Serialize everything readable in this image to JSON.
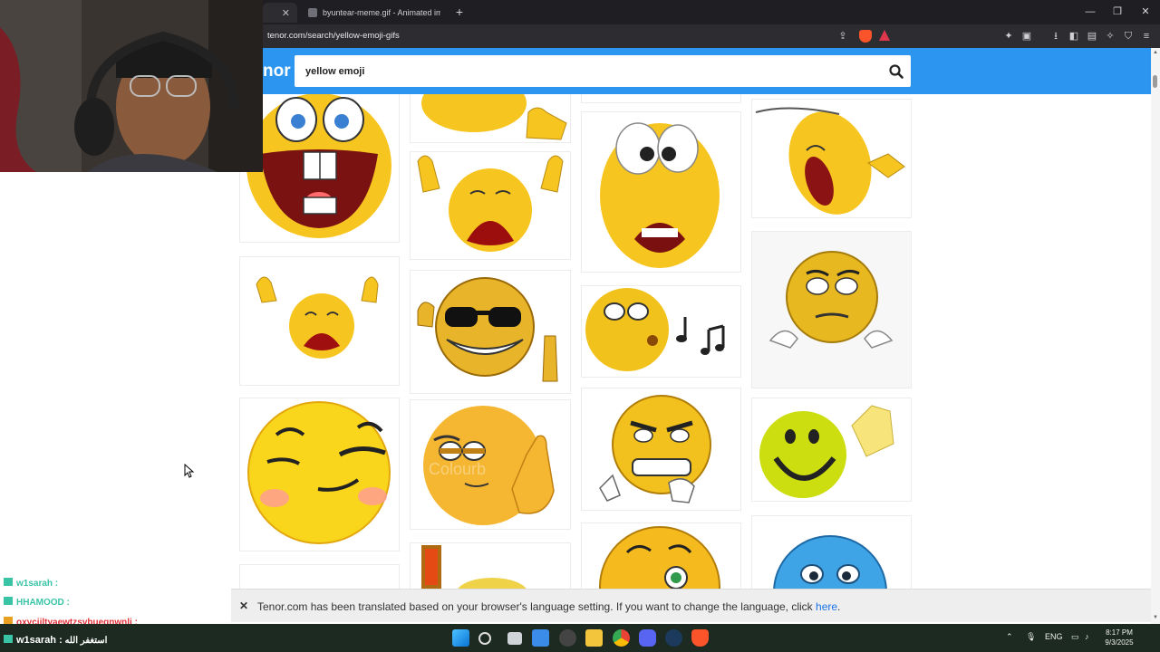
{
  "browser": {
    "tabs": [
      {
        "label": ""
      },
      {
        "label": "byuntear-meme.gif - Animated imag"
      }
    ],
    "url": "tenor.com/search/yellow-emoji-gifs"
  },
  "tenor": {
    "logo_text": "nor",
    "search_value": "yellow emoji"
  },
  "translation_bar": {
    "message": "Tenor.com has been translated based on your browser's language setting. If you want to change the language, click ",
    "link": "here",
    "period": "."
  },
  "stream_overlay": {
    "chat": [
      {
        "user": "w1sarah :",
        "text": "",
        "color": "#3ac4a6"
      },
      {
        "user": "HHAMOOD :",
        "text": "",
        "color": "#3ac4a6"
      },
      {
        "user": "oxyciiltyaewtzsvbuegnwnli :",
        "text": "",
        "color": "#e0323a"
      },
      {
        "user": "w1sarah :",
        "text": "استغفر الله",
        "color": "#ffffff"
      }
    ]
  },
  "taskbar": {
    "language": "ENG",
    "time": "8:17 PM",
    "date": "9/3/2025"
  },
  "colors": {
    "tenor_blue": "#2c95ef",
    "emoji_yellow": "#f7c520"
  },
  "gif_grid": [
    {
      "name": "laughing-big-teeth",
      "icon": "laughing-emoji"
    },
    {
      "name": "thumbs-up-partial",
      "icon": "emoji-partial"
    },
    {
      "name": "crying-hands-up",
      "icon": "crying-emoji"
    },
    {
      "name": "crying-hands-up-small",
      "icon": "crying-emoji"
    },
    {
      "name": "cool-sunglasses-thumbs-up",
      "icon": "sunglasses-emoji"
    },
    {
      "name": "smug-blush",
      "icon": "smug-emoji"
    },
    {
      "name": "thinking-colourbox",
      "icon": "thinking-emoji"
    },
    {
      "name": "shocked-wide-eyes",
      "icon": "shocked-emoji"
    },
    {
      "name": "whistling-music-notes",
      "icon": "whistling-emoji"
    },
    {
      "name": "grimacing-clenched",
      "icon": "grimacing-emoji"
    },
    {
      "name": "laughing-tilted",
      "icon": "laughing-emoji"
    },
    {
      "name": "worried-sitting",
      "icon": "worried-emoji"
    },
    {
      "name": "pixel-smile-waving",
      "icon": "waving-emoji"
    },
    {
      "name": "blue-sad",
      "icon": "blue-emoji"
    }
  ]
}
